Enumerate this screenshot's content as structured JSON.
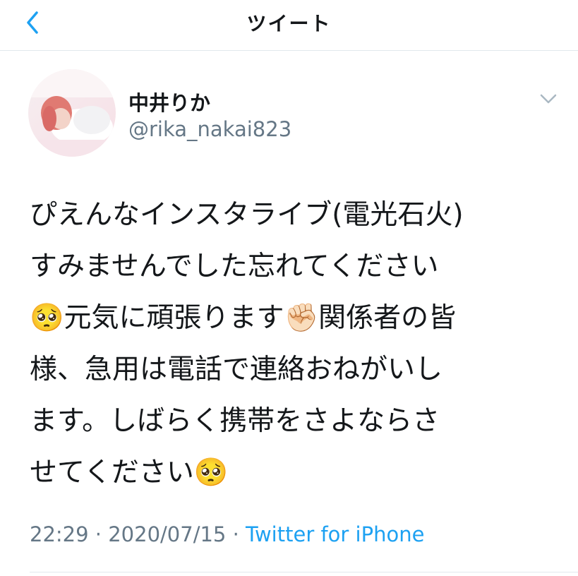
{
  "header": {
    "title": "ツイート",
    "back_icon": "chevron-left-icon",
    "accent_color": "#1da1f2"
  },
  "author": {
    "display_name": "中井りか",
    "handle": "@rika_nakai823",
    "avatar_icon": "profile-photo",
    "menu_icon": "chevron-down-icon"
  },
  "tweet": {
    "lines": [
      "ぴえんなインスタライブ(電光石火)",
      "すみませんでした忘れてください",
      "🥺元気に頑張ります✊🏻関係者の皆",
      "様、急用は電話で連絡おねがいし",
      "ます。しばらく携帯をさよならさ",
      "せてください🥺"
    ]
  },
  "meta": {
    "time": "22:29",
    "separator": " · ",
    "date": "2020/07/15",
    "source": "Twitter for iPhone"
  },
  "colors": {
    "text": "#14171a",
    "secondary": "#657786",
    "link": "#1da1f2",
    "divider": "#e1e8ed"
  }
}
